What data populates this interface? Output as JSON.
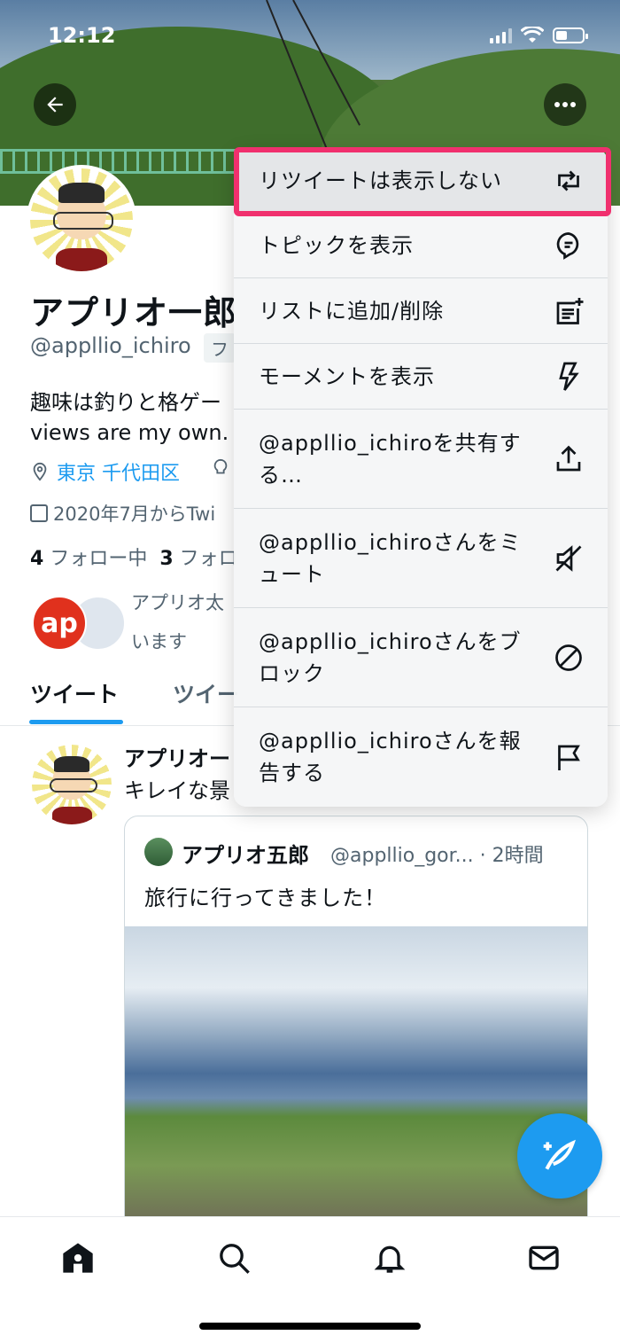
{
  "status_bar": {
    "time": "12:12"
  },
  "profile": {
    "name": "アプリオ一郎",
    "handle": "@appllio_ichiro",
    "follows_badge": "フ",
    "bio_line1": "趣味は釣りと格ゲー",
    "bio_line2": "views are my own.",
    "location": "東京 千代田区",
    "joined": "2020年7月からTwi",
    "following_count": "4",
    "following_label": "フォロー中",
    "followers_count": "3",
    "followers_label": "フォロ",
    "follower_avatar_text": "ap",
    "followed_by_line1": "アプリオ太",
    "followed_by_line2": "います"
  },
  "tabs": {
    "tweets": "ツイート",
    "replies": "ツイー"
  },
  "tweet": {
    "author": "アプリオー",
    "text": "キレイな景",
    "quote": {
      "name": "アプリオ五郎",
      "handle_time": "@appllio_gor... · 2時間",
      "text": "旅行に行ってきました！"
    }
  },
  "menu": {
    "hide_retweets": "リツイートは表示しない",
    "view_topics": "トピックを表示",
    "lists": "リストに追加/削除",
    "moments": "モーメントを表示",
    "share": "@appllio_ichiroを共有する…",
    "mute": "@appllio_ichiroさんをミュート",
    "block": "@appllio_ichiroさんをブロック",
    "report": "@appllio_ichiroさんを報告する"
  },
  "colors": {
    "accent": "#1d9bf0",
    "highlight": "#f0306e"
  }
}
